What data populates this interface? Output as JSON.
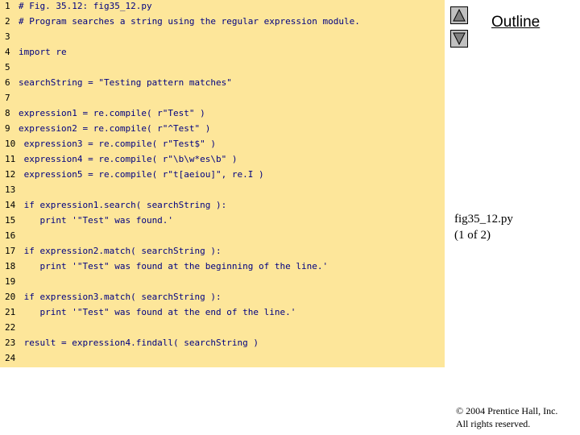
{
  "code_lines": [
    {
      "num": "1",
      "text": "# Fig. 35.12: fig35_12.py"
    },
    {
      "num": "2",
      "text": "# Program searches a string using the regular expression module."
    },
    {
      "num": "3",
      "text": ""
    },
    {
      "num": "4",
      "text": "import re"
    },
    {
      "num": "5",
      "text": ""
    },
    {
      "num": "6",
      "text": "searchString = \"Testing pattern matches\""
    },
    {
      "num": "7",
      "text": ""
    },
    {
      "num": "8",
      "text": "expression1 = re.compile( r\"Test\" )"
    },
    {
      "num": "9",
      "text": "expression2 = re.compile( r\"^Test\" )"
    },
    {
      "num": "10",
      "text": " expression3 = re.compile( r\"Test$\" )"
    },
    {
      "num": "11",
      "text": " expression4 = re.compile( r\"\\b\\w*es\\b\" )"
    },
    {
      "num": "12",
      "text": " expression5 = re.compile( r\"t[aeiou]\", re.I )"
    },
    {
      "num": "13",
      "text": ""
    },
    {
      "num": "14",
      "text": " if expression1.search( searchString ):"
    },
    {
      "num": "15",
      "text": "    print '\"Test\" was found.'"
    },
    {
      "num": "16",
      "text": ""
    },
    {
      "num": "17",
      "text": " if expression2.match( searchString ):"
    },
    {
      "num": "18",
      "text": "    print '\"Test\" was found at the beginning of the line.'"
    },
    {
      "num": "19",
      "text": ""
    },
    {
      "num": "20",
      "text": " if expression3.match( searchString ):"
    },
    {
      "num": "21",
      "text": "    print '\"Test\" was found at the end of the line.'"
    },
    {
      "num": "22",
      "text": ""
    },
    {
      "num": "23",
      "text": " result = expression4.findall( searchString )"
    },
    {
      "num": "24",
      "text": ""
    }
  ],
  "sidebar": {
    "outline_label": "Outline",
    "file_caption": "fig35_12.py",
    "page_caption": "(1 of 2)",
    "copyright_line1": "© 2004 Prentice Hall, Inc.",
    "copyright_line2": "All rights reserved."
  },
  "icons": {
    "up": "triangle-up-icon",
    "down": "triangle-down-icon"
  },
  "colors": {
    "code_background": "#fde69a",
    "code_text": "#000080",
    "button_gray": "#c0c0c0"
  }
}
